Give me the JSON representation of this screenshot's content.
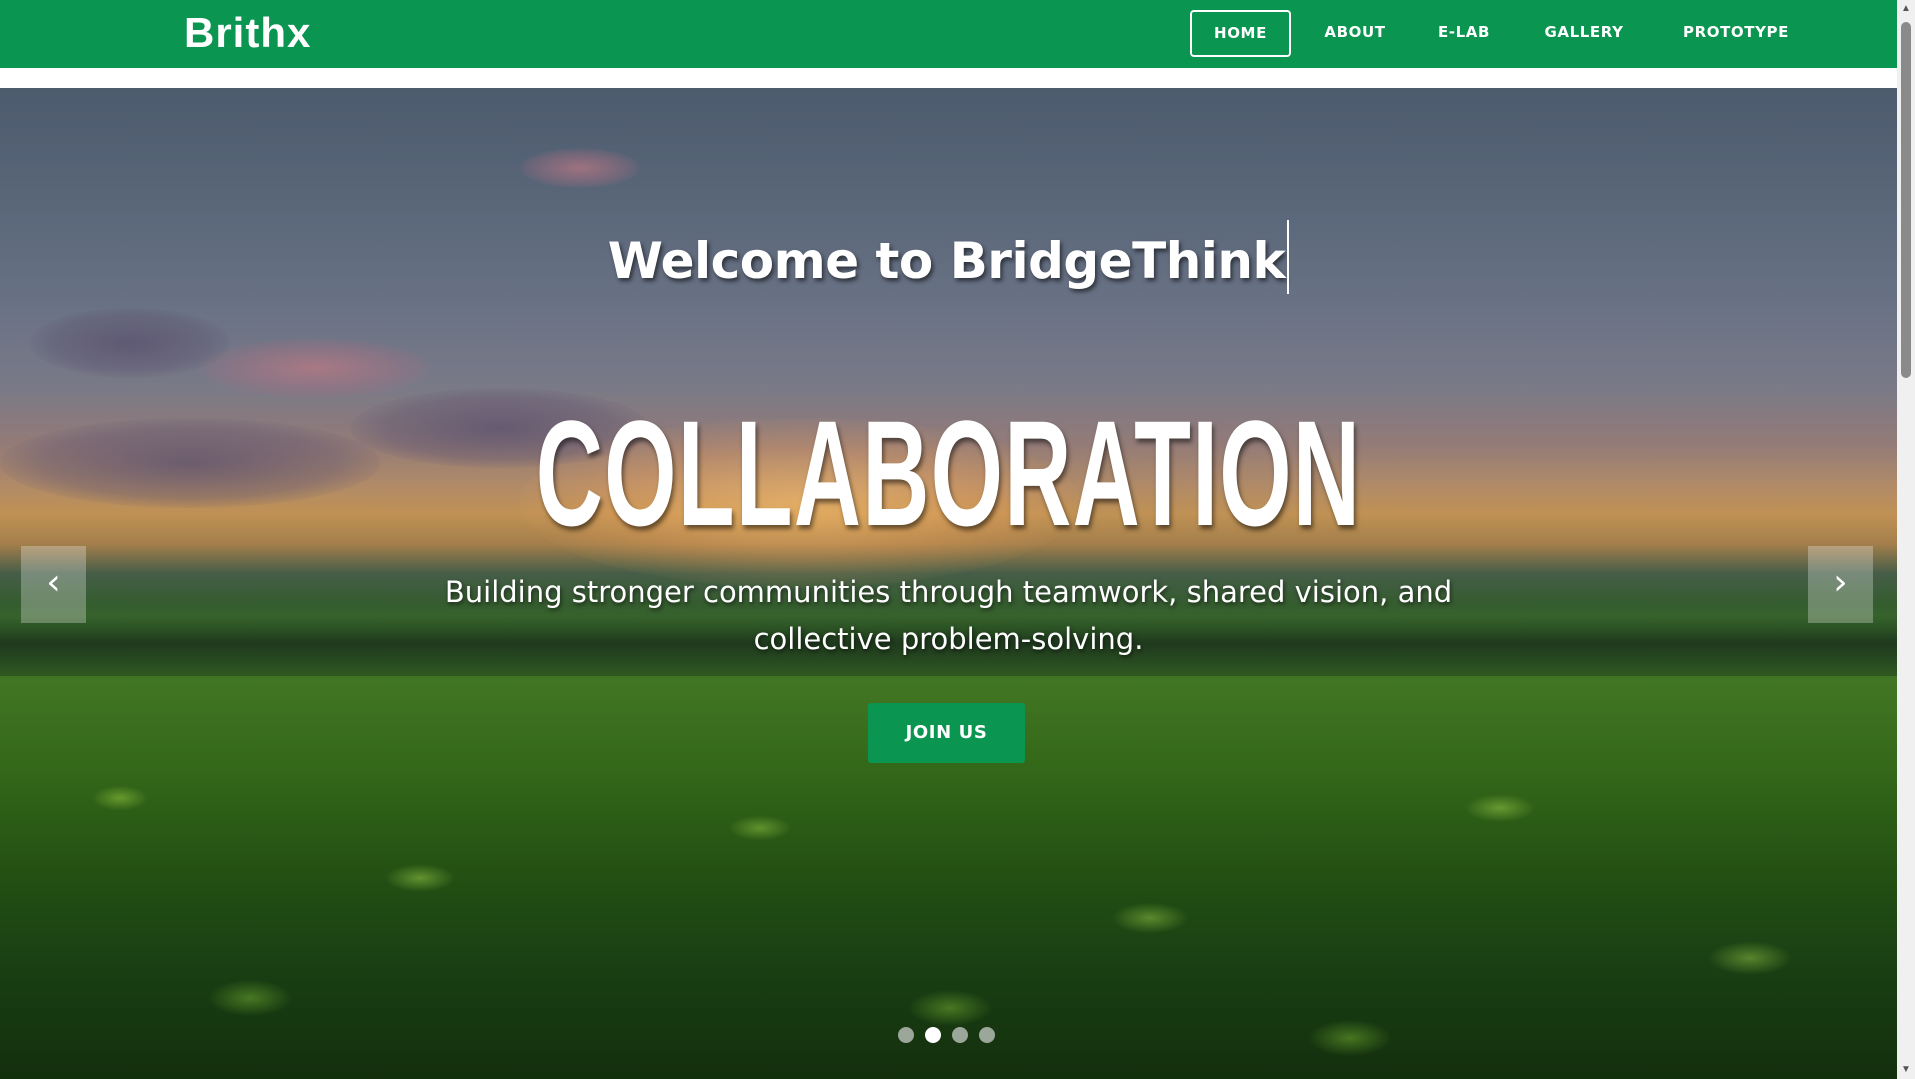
{
  "brand": {
    "name": "Brithx"
  },
  "nav": {
    "items": [
      {
        "label": "HOME",
        "active": true
      },
      {
        "label": "ABOUT",
        "active": false
      },
      {
        "label": "E-LAB",
        "active": false
      },
      {
        "label": "GALLERY",
        "active": false
      },
      {
        "label": "PROTOTYPE",
        "active": false
      }
    ]
  },
  "hero": {
    "greeting": "Welcome to BridgeThink",
    "heading": "COLLABORATION",
    "text": "Building stronger communities through teamwork, shared vision, and collective problem-solving.",
    "cta_label": "JOIN US",
    "prev_icon": "‹",
    "next_icon": "›"
  },
  "carousel": {
    "slide_count": 4,
    "active_index": 1
  },
  "colors": {
    "brand_green": "#0a9550",
    "text_white": "#ffffff"
  }
}
